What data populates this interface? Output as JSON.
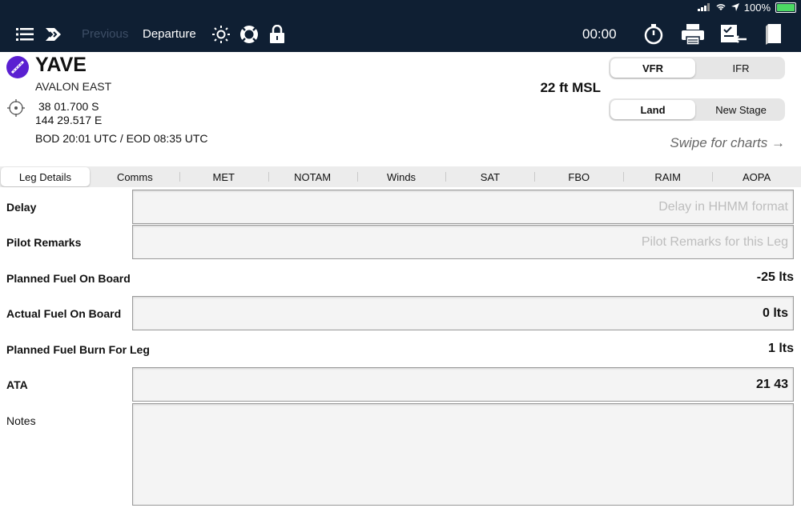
{
  "status": {
    "battery_text": "100%"
  },
  "toolbar": {
    "previous_label": "Previous",
    "current_label": "Departure",
    "timer": "00:00",
    "icons": [
      "list-icon",
      "route-arrow-icon",
      "brightness-icon",
      "lifebuoy-icon",
      "lock-icon",
      "stopwatch-icon",
      "printer-icon",
      "checklist-icon",
      "book-icon"
    ]
  },
  "airport": {
    "ident": "YAVE",
    "name": "AVALON EAST",
    "lat": "38 01.700 S",
    "lon": "144 29.517 E",
    "bod_eod": "BOD 20:01 UTC / EOD 08:35 UTC",
    "elevation": "22 ft MSL",
    "badge_color": "#5a1fd1"
  },
  "rules_toggle": {
    "options": [
      "VFR",
      "IFR"
    ],
    "selected": "VFR"
  },
  "stage_toggle": {
    "options": [
      "Land",
      "New Stage"
    ],
    "selected": "Land"
  },
  "swipe_hint": "Swipe for charts →",
  "tabs": [
    "Leg Details",
    "Comms",
    "MET",
    "NOTAM",
    "Winds",
    "SAT",
    "FBO",
    "RAIM",
    "AOPA"
  ],
  "active_tab": "Leg Details",
  "fields": {
    "delay": {
      "label": "Delay",
      "placeholder": "Delay in HHMM format"
    },
    "pilot_remarks": {
      "label": "Pilot Remarks",
      "placeholder": "Pilot Remarks for this Leg"
    },
    "planned_fuel": {
      "label": "Planned Fuel On Board",
      "value": "-25 lts"
    },
    "actual_fuel": {
      "label": "Actual Fuel On Board",
      "value": "0 lts"
    },
    "planned_burn": {
      "label": "Planned Fuel Burn For Leg",
      "value": "1 lts"
    },
    "ata": {
      "label": "ATA",
      "value": "21 43"
    },
    "notes": {
      "label": "Notes"
    }
  }
}
